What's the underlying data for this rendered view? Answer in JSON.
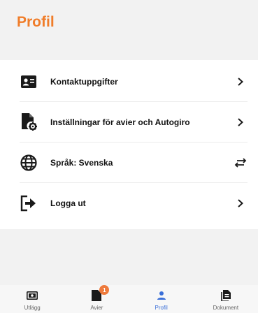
{
  "colors": {
    "accent": "#f07d2a",
    "active_tab": "#3a6fd8",
    "badge": "#ee7a3c",
    "icon": "#1a1a1a"
  },
  "header": {
    "title": "Profil"
  },
  "menu": {
    "items": [
      {
        "label": "Kontaktuppgifter",
        "icon": "contact-card-icon",
        "action_icon": "chevron-right-icon"
      },
      {
        "label": "Inställningar för avier och Autogiro",
        "icon": "document-settings-icon",
        "action_icon": "chevron-right-icon"
      },
      {
        "label": "Språk: Svenska",
        "icon": "globe-icon",
        "action_icon": "swap-arrows-icon"
      },
      {
        "label": "Logga ut",
        "icon": "logout-icon",
        "action_icon": "chevron-right-icon"
      }
    ]
  },
  "tabbar": {
    "tabs": [
      {
        "label": "Utlägg",
        "icon": "money-bill-icon",
        "active": false
      },
      {
        "label": "Avier",
        "icon": "document-icon",
        "active": false,
        "badge": "1"
      },
      {
        "label": "Profil",
        "icon": "person-icon",
        "active": true
      },
      {
        "label": "Dokument",
        "icon": "documents-stack-icon",
        "active": false
      }
    ]
  }
}
